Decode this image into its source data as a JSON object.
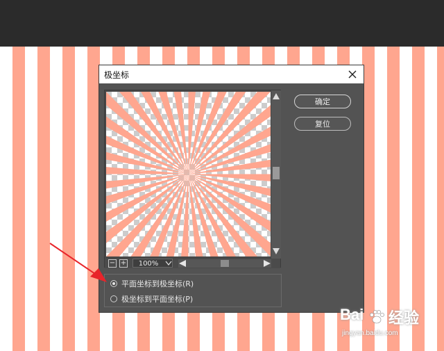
{
  "dialog": {
    "title": "极坐标",
    "ok_label": "确定",
    "reset_label": "复位",
    "zoom_value": "100%",
    "options": [
      {
        "label": "平面坐标到极坐标(R)",
        "selected": true
      },
      {
        "label": "极坐标到平面坐标(P)",
        "selected": false
      }
    ]
  },
  "icons": {
    "close": "close-icon",
    "zoom_out": "zoom-out-icon",
    "zoom_in": "zoom-in-icon",
    "dropdown": "chevron-down-icon"
  },
  "colors": {
    "stripe": "#ffa68f",
    "dialog_bg": "#535353",
    "topbar": "#2b2b2b",
    "arrow": "#e8242a"
  },
  "watermark": {
    "brand": "Bai",
    "brand_suffix": "经验",
    "url": "jingyan.baidu.com"
  }
}
